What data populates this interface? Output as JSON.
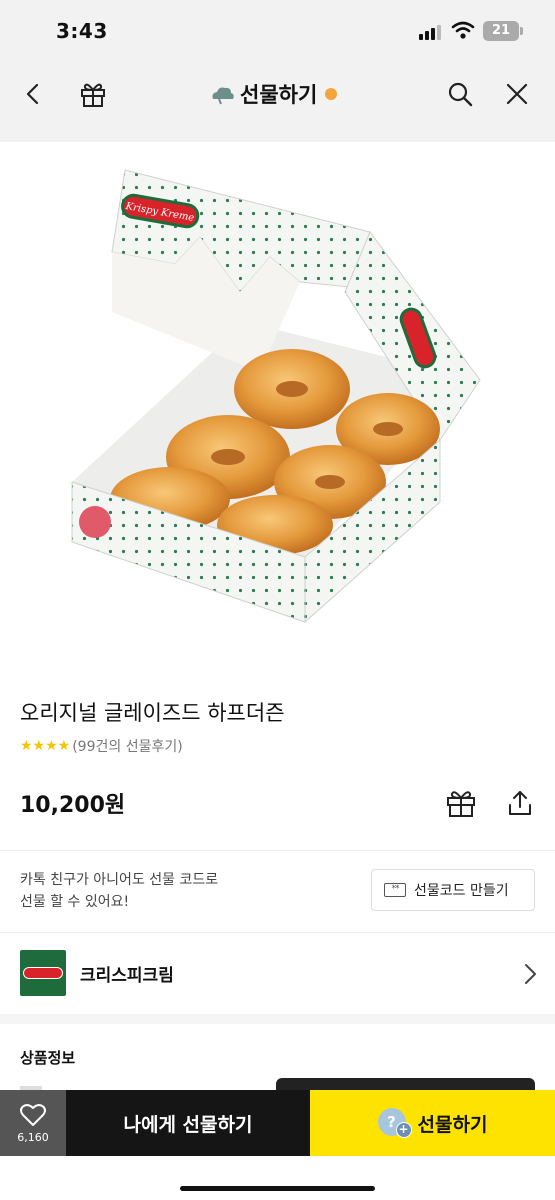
{
  "status_bar": {
    "time": "3:43",
    "battery": "21"
  },
  "nav": {
    "title": "선물하기"
  },
  "product": {
    "image_alt": "Krispy Kreme box with glazed donuts",
    "brand_print": "Krispy Kreme",
    "name": "오리지널 글레이즈드 하프더즌",
    "stars": "★★★★",
    "review_count": "(99건의 선물후기)",
    "price": "10,200원"
  },
  "gift_code": {
    "line1": "카톡 친구가 아니어도 선물 코드로",
    "line2": "선물 할 수 있어요!",
    "icon_text": "**",
    "button_label": "선물코드 만들기"
  },
  "brand": {
    "name": "크리스피크림"
  },
  "section": {
    "title": "상품정보"
  },
  "bottom_bar": {
    "wish_count": "6,160",
    "gift_me_label": "나에게 선물하기",
    "gift_label": "선물하기",
    "avatar_q": "?",
    "avatar_plus": "+"
  },
  "colors": {
    "accent_yellow": "#ffe300",
    "dark": "#151515",
    "star": "#f6c400",
    "brand_green": "#1e6b3b",
    "brand_red": "#d8232a"
  }
}
